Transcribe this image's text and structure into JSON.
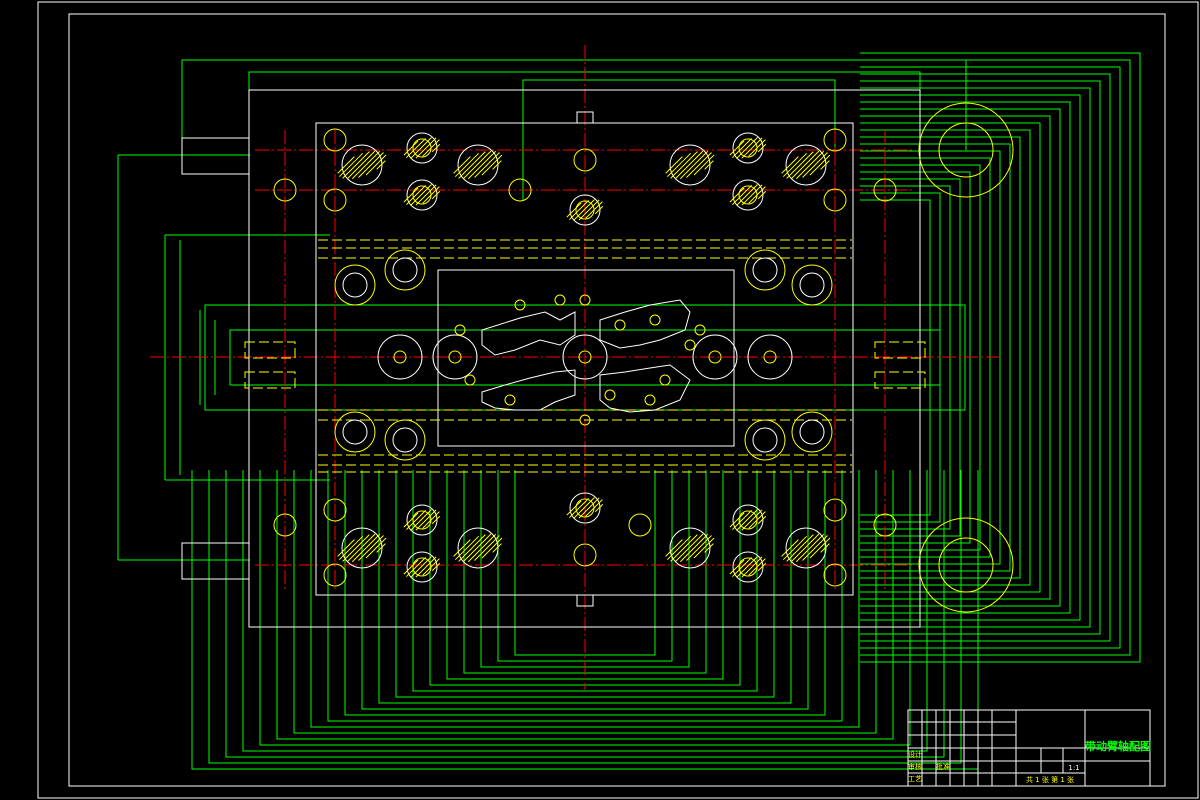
{
  "colors": {
    "background": "#000000",
    "frame": "#ffffff",
    "dimension": "#00ff00",
    "centerline": "#ff0000",
    "hidden": "#ffff00",
    "feature": "#ffffff"
  },
  "title_block": {
    "drawing_title": "带动臂轴配图",
    "scale": "1:1",
    "sheet_info": "共 1 张  第 1 张",
    "sign_labels": [
      "设计",
      "审核",
      "工艺",
      "批准"
    ]
  }
}
